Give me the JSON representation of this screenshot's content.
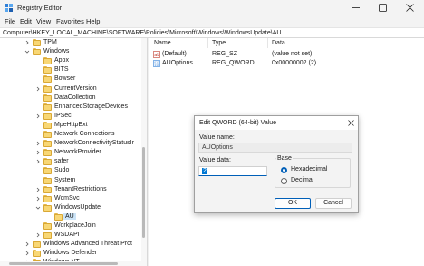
{
  "window": {
    "title": "Registry Editor",
    "icon": "registry-icon"
  },
  "menu": [
    "File",
    "Edit",
    "View",
    "Favorites",
    "Help"
  ],
  "address": "Computer\\HKEY_LOCAL_MACHINE\\SOFTWARE\\Policies\\Microsoft\\Windows\\WindowsUpdate\\AU",
  "tree": [
    {
      "label": "TPM",
      "chevron": "right"
    },
    {
      "label": "Windows",
      "chevron": "down"
    },
    {
      "label": "Appx",
      "chevron": "none"
    },
    {
      "label": "BITS",
      "chevron": "none"
    },
    {
      "label": "Bowser",
      "chevron": "none"
    },
    {
      "label": "CurrentVersion",
      "chevron": "right"
    },
    {
      "label": "DataCollection",
      "chevron": "none"
    },
    {
      "label": "EnhancedStorageDevices",
      "chevron": "none"
    },
    {
      "label": "IPSec",
      "chevron": "right"
    },
    {
      "label": "MpeHttpExt",
      "chevron": "none"
    },
    {
      "label": "Network Connections",
      "chevron": "none"
    },
    {
      "label": "NetworkConnectivityStatusIr",
      "chevron": "right"
    },
    {
      "label": "NetworkProvider",
      "chevron": "right"
    },
    {
      "label": "safer",
      "chevron": "right"
    },
    {
      "label": "Sudo",
      "chevron": "none"
    },
    {
      "label": "System",
      "chevron": "none"
    },
    {
      "label": "TenantRestrictions",
      "chevron": "right"
    },
    {
      "label": "WcmSvc",
      "chevron": "right"
    },
    {
      "label": "WindowsUpdate",
      "chevron": "down"
    },
    {
      "label": "AU",
      "chevron": "none",
      "selected": true
    },
    {
      "label": "WorkplaceJoin",
      "chevron": "none"
    },
    {
      "label": "WSDAPI",
      "chevron": "right"
    },
    {
      "label": "Windows Advanced Threat Prot",
      "chevron": "right"
    },
    {
      "label": "Windows Defender",
      "chevron": "right"
    },
    {
      "label": "Windows NT",
      "chevron": "right"
    }
  ],
  "list": {
    "headers": {
      "name": "Name",
      "type": "Type",
      "data": "Data"
    },
    "rows": [
      {
        "name": "(Default)",
        "type": "REG_SZ",
        "data": "(value not set)",
        "icon": "string-value-icon"
      },
      {
        "name": "AUOptions",
        "type": "REG_QWORD",
        "data": "0x00000002 (2)",
        "icon": "binary-value-icon"
      }
    ]
  },
  "dialog": {
    "title": "Edit QWORD (64-bit) Value",
    "value_name_label": "Value name:",
    "value_name": "AUOptions",
    "value_data_label": "Value data:",
    "value_data": "2",
    "base_label": "Base",
    "base_options": [
      {
        "label": "Hexadecimal",
        "checked": true
      },
      {
        "label": "Decimal",
        "checked": false
      }
    ],
    "ok_label": "OK",
    "cancel_label": "Cancel"
  },
  "colors": {
    "accent": "#005fb8",
    "selection": "#cce4f7",
    "folder": "#f8d775"
  }
}
